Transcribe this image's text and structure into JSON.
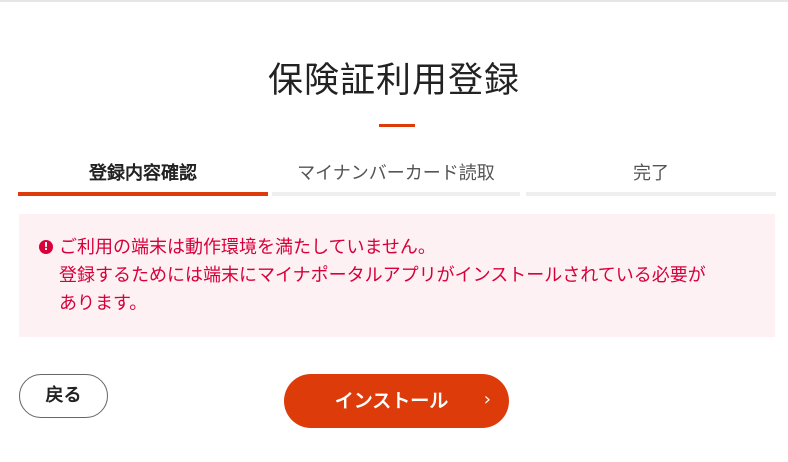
{
  "header": {
    "title": "保険証利用登録"
  },
  "steps": [
    {
      "label": "登録内容確認",
      "active": true
    },
    {
      "label": "マイナンバーカード読取",
      "active": false
    },
    {
      "label": "完了",
      "active": false
    }
  ],
  "alert": {
    "icon": "exclamation-circle-icon",
    "color": "#d7003a",
    "lines": [
      "ご利用の端末は動作環境を満たしていません。",
      "登録するためには端末にマイナポータルアプリがインストールされている必要が",
      "あります。"
    ]
  },
  "actions": {
    "back_label": "戻る",
    "install_label": "インストール",
    "install_icon": "chevron-right-icon"
  },
  "colors": {
    "accent": "#de3b0a",
    "alert_bg": "#fdf1f3"
  }
}
